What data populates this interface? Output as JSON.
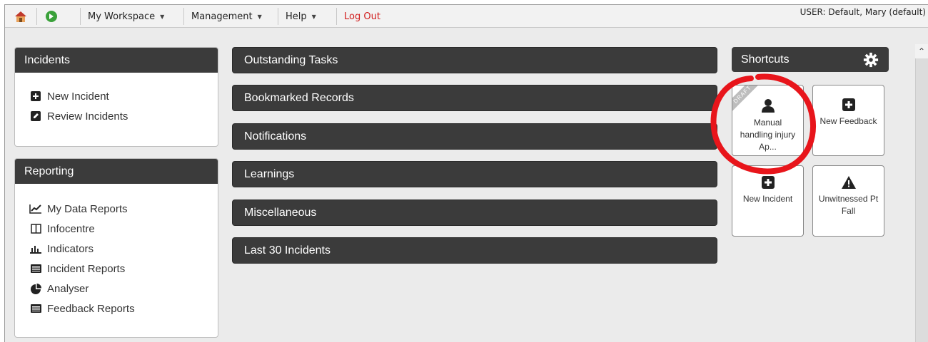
{
  "menubar": {
    "icons": [
      "home-icon",
      "forward-arrow-icon"
    ],
    "items": [
      {
        "label": "My Workspace",
        "has_caret": true
      },
      {
        "label": "Management",
        "has_caret": true
      },
      {
        "label": "Help",
        "has_caret": true
      }
    ],
    "logout_label": "Log Out",
    "user_text": "USER: Default, Mary (default)",
    "logout_color": "#d11b1b"
  },
  "incidents_panel": {
    "title": "Incidents",
    "items": [
      {
        "label": "New Incident",
        "icon": "plus-square-icon"
      },
      {
        "label": "Review Incidents",
        "icon": "edit-icon"
      }
    ]
  },
  "reporting_panel": {
    "title": "Reporting",
    "items": [
      {
        "label": "My Data Reports",
        "icon": "line-chart-icon"
      },
      {
        "label": "Infocentre",
        "icon": "columns-icon"
      },
      {
        "label": "Indicators",
        "icon": "bar-chart-icon"
      },
      {
        "label": "Incident Reports",
        "icon": "list-icon"
      },
      {
        "label": "Analyser",
        "icon": "pie-chart-icon"
      },
      {
        "label": "Feedback Reports",
        "icon": "list-icon"
      }
    ]
  },
  "sections": [
    {
      "label": "Outstanding Tasks"
    },
    {
      "label": "Bookmarked Records"
    },
    {
      "label": "Notifications"
    },
    {
      "label": "Learnings"
    },
    {
      "label": "Miscellaneous"
    },
    {
      "label": "Last 30 Incidents"
    }
  ],
  "shortcuts": {
    "title": "Shortcuts",
    "settings_icon": "gear-icon",
    "tiles": [
      {
        "label": "Manual handling injury Ap...",
        "icon": "user-icon",
        "badge": "DRAFT"
      },
      {
        "label": "New Feedback",
        "icon": "plus-square-icon"
      },
      {
        "label": "New Incident",
        "icon": "plus-square-icon"
      },
      {
        "label": "Unwitnessed Pt Fall",
        "icon": "warning-icon"
      }
    ],
    "annotation_color": "#e8151b"
  },
  "colors": {
    "header_bg": "#3b3b3b",
    "page_bg": "#ebebeb"
  }
}
